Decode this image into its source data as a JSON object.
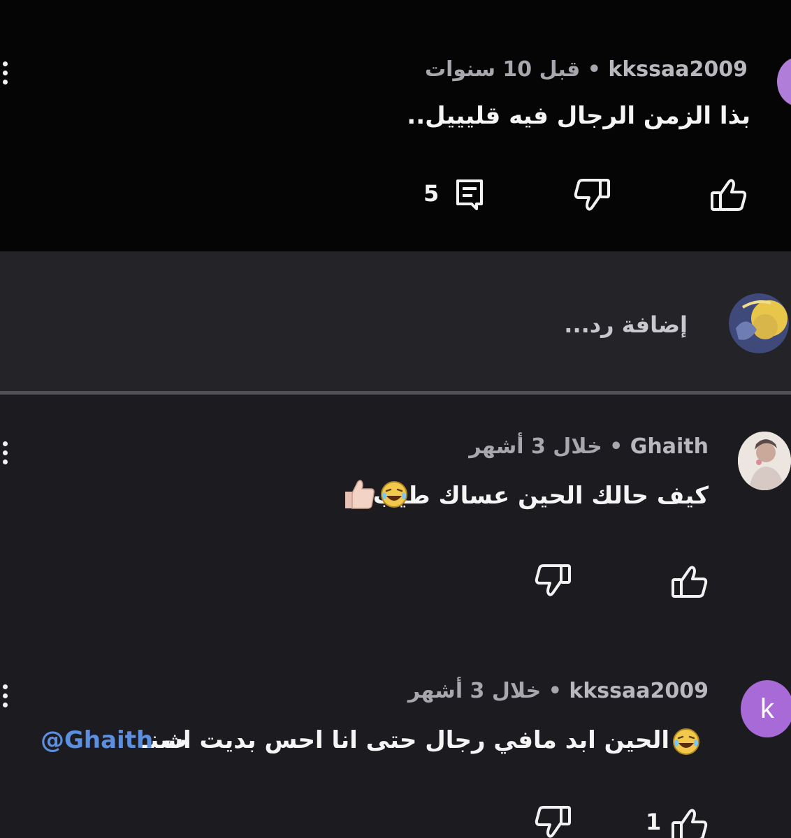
{
  "thread": {
    "top_comment": {
      "username": "kkssaa2009",
      "time": "قبل 10 سنوات",
      "separator": "•",
      "text": "بذا الزمن الرجال فيه قليييل..",
      "reply_count": "5"
    },
    "reply_box": {
      "placeholder": "إضافة رد..."
    },
    "replies": [
      {
        "username": "Ghaith",
        "time": "خلال 3 أشهر",
        "separator": "•",
        "text": "كيف حالك الحين عساك طيب",
        "avatar_style": "photo"
      },
      {
        "username": "kkssaa2009",
        "time": "خلال 3 أشهر",
        "separator": "•",
        "text": "الحين ابد مافي رجال حتى انا احس بديت اسنـ",
        "cut_char": "ث",
        "mention": "@Ghaith",
        "avatar_letter": "k",
        "like_count": "1"
      }
    ]
  },
  "colors": {
    "top_band": "#050505",
    "reply_band": "#242328",
    "body": "#1c1b20",
    "avatar_purple": "#a86ad6",
    "mention_blue": "#5c8fe0"
  },
  "icons": {
    "like": "thumbs-up-icon",
    "dislike": "thumbs-down-icon",
    "reply": "comment-icon",
    "menu": "more-vert-icon"
  }
}
